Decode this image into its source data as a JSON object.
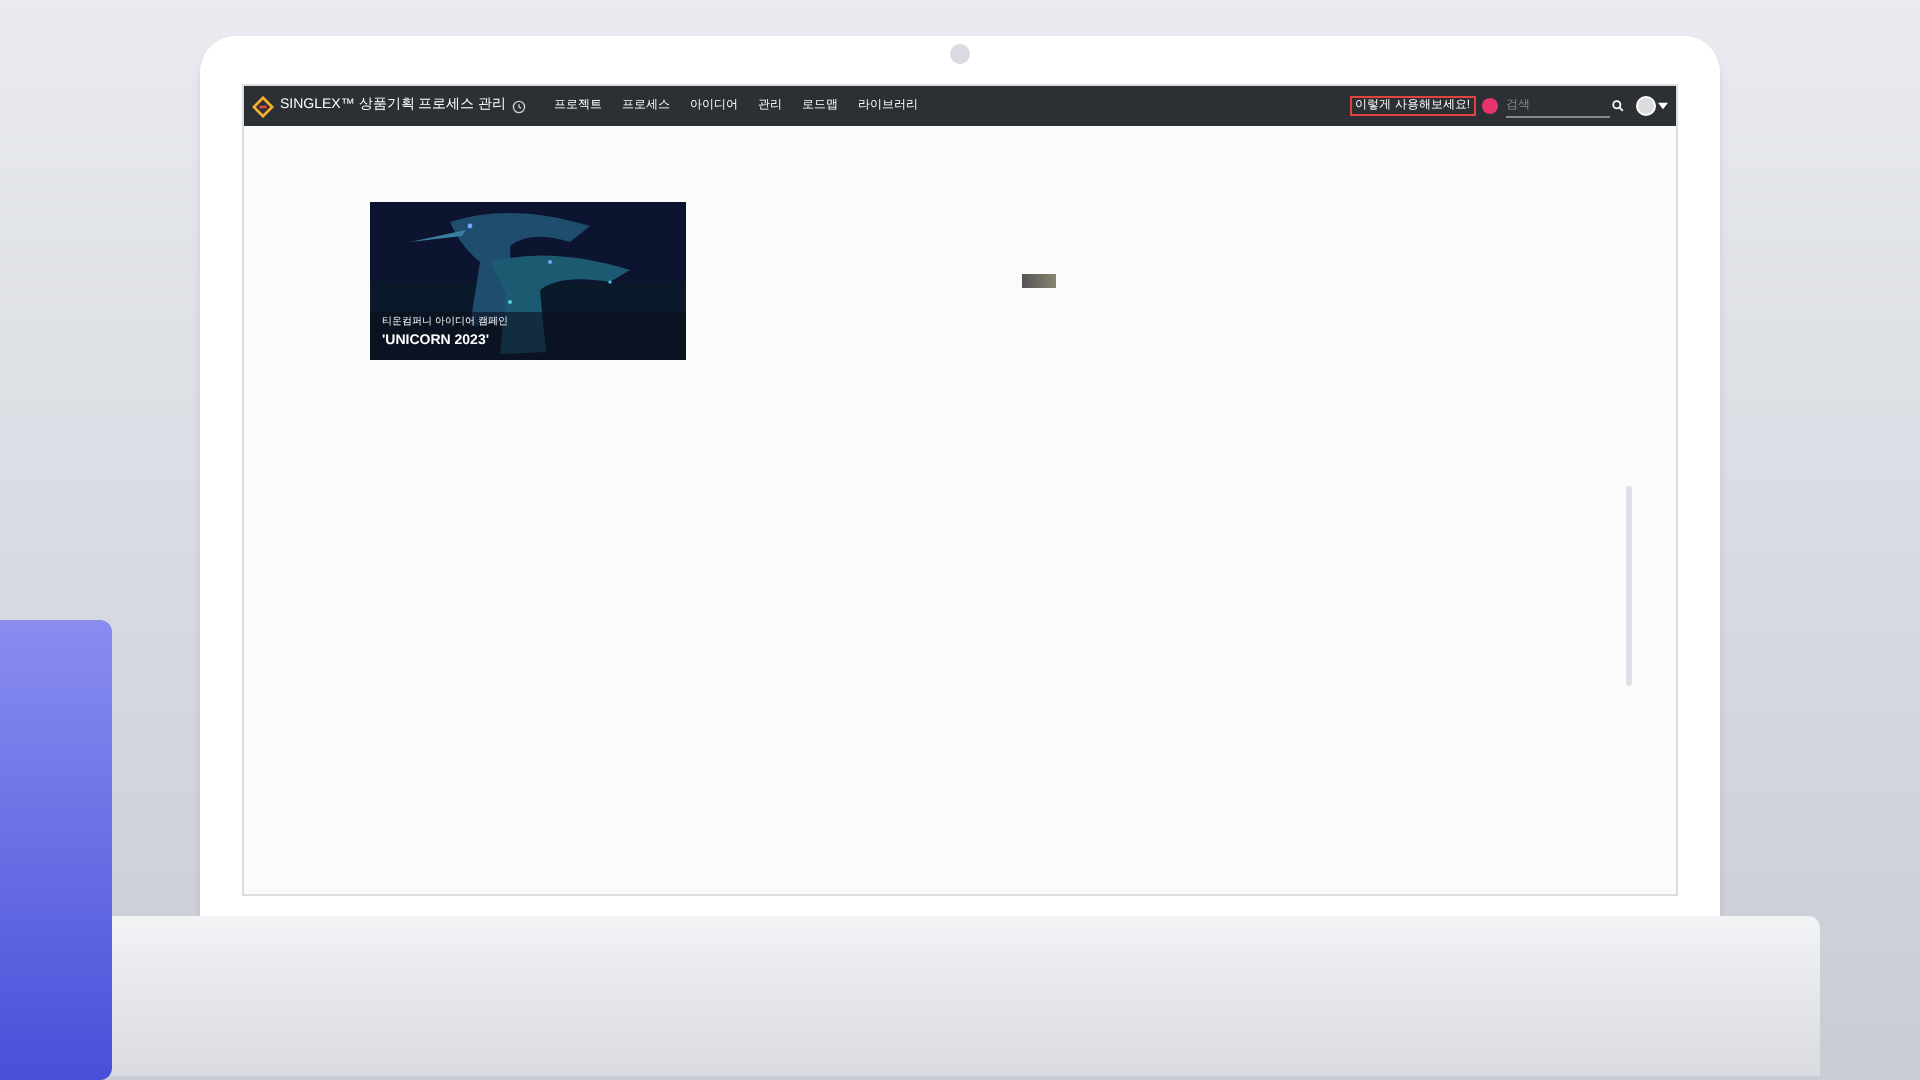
{
  "app": {
    "brand": "SINGLEX™ 상품기획 프로세스 관리"
  },
  "nav": [
    {
      "label": "프로젝트"
    },
    {
      "label": "프로세스"
    },
    {
      "label": "아이디어"
    },
    {
      "label": "관리"
    },
    {
      "label": "로드맵"
    },
    {
      "label": "라이브러리"
    }
  ],
  "help_button": "이렇게 사용해보세요!",
  "search": {
    "placeholder": "검색"
  },
  "banner": {
    "kind": "picture",
    "subtitle": "티운컴퍼니 아이디어 캠페인",
    "title": "'UNICORN 2023'"
  }
}
